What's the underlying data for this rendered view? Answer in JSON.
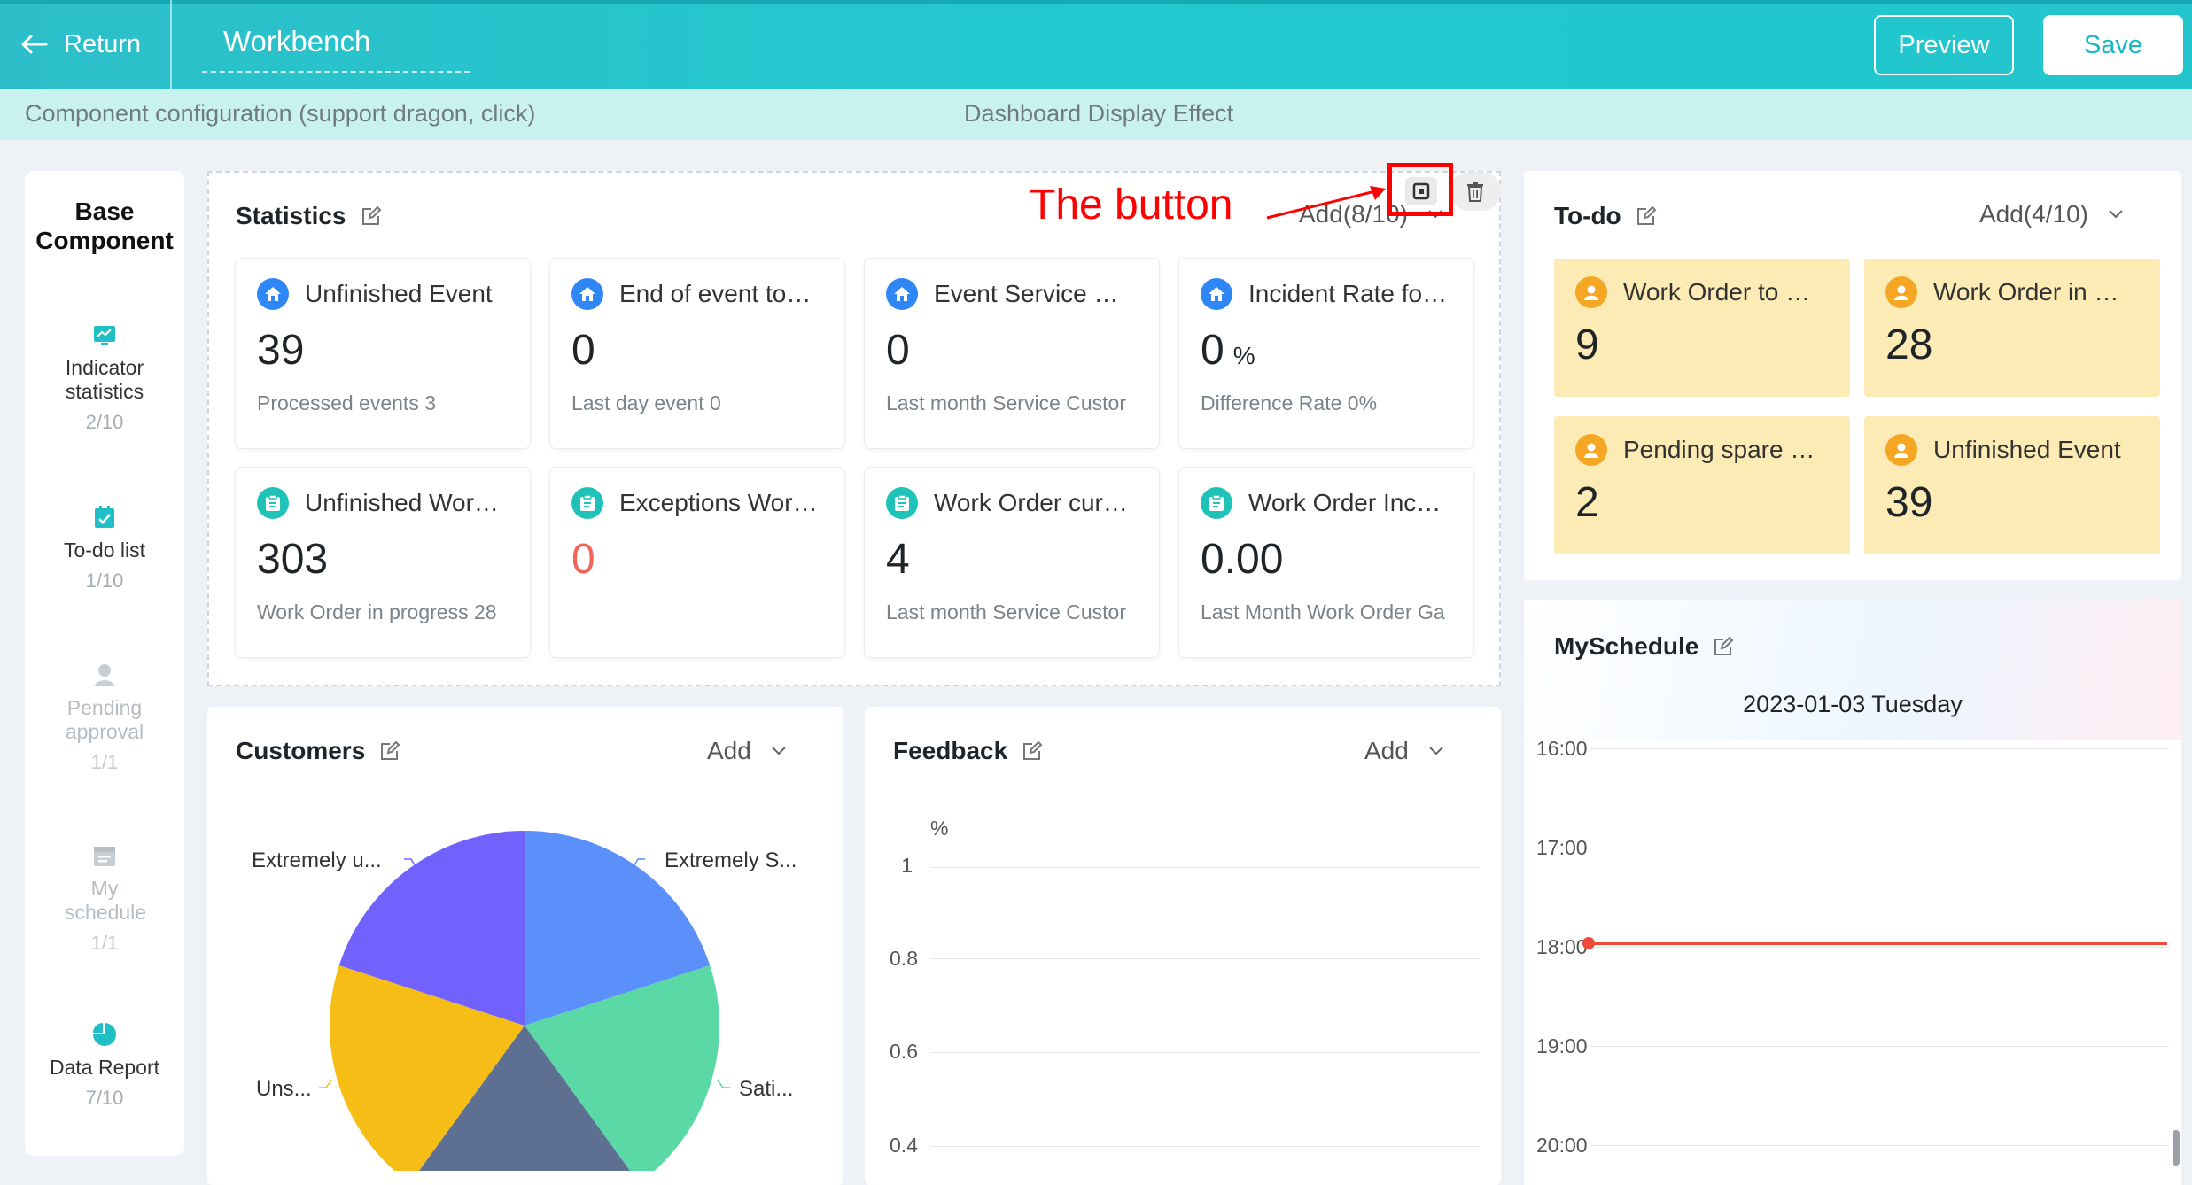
{
  "header": {
    "return_label": "Return",
    "title": "Workbench",
    "preview_label": "Preview",
    "save_label": "Save"
  },
  "subheader": {
    "left": "Component configuration (support dragon, click)",
    "center": "Dashboard Display Effect"
  },
  "palette": {
    "title": "Base Component",
    "items": [
      {
        "label": "Indicator statistics",
        "count": "2/10",
        "icon": "chart-icon",
        "enabled": true
      },
      {
        "label": "To-do list",
        "count": "1/10",
        "icon": "checklist-icon",
        "enabled": true
      },
      {
        "label": "Pending approval",
        "count": "1/1",
        "icon": "user-icon",
        "enabled": false
      },
      {
        "label": "My schedule",
        "count": "1/1",
        "icon": "calendar-icon",
        "enabled": false
      },
      {
        "label": "Data Report",
        "count": "7/10",
        "icon": "pie-chart-icon",
        "enabled": true
      }
    ]
  },
  "annotation": {
    "text": "The button"
  },
  "statistics": {
    "title": "Statistics",
    "add_label": "Add(8/10)",
    "tiles": [
      {
        "title": "Unfinished Event",
        "value": "39",
        "unit": "",
        "footer": "Processed events  3",
        "icon": "home-icon",
        "color": "#2f87f5"
      },
      {
        "title": "End of event to…",
        "value": "0",
        "unit": "",
        "footer": "Last day event  0",
        "icon": "home-icon",
        "color": "#2f87f5"
      },
      {
        "title": "Event Service …",
        "value": "0",
        "unit": "",
        "footer": "Last month Service Custor",
        "icon": "home-icon",
        "color": "#2f87f5"
      },
      {
        "title": "Incident Rate fo…",
        "value": "0",
        "unit": "%",
        "footer": "Difference Rate  0%",
        "icon": "home-icon",
        "color": "#2f87f5"
      },
      {
        "title": "Unfinished Wor…",
        "value": "303",
        "unit": "",
        "footer": "Work Order in progress  28",
        "icon": "clipboard-icon",
        "color": "#1fc2b6"
      },
      {
        "title": "Exceptions Wor…",
        "value": "0",
        "unit": "",
        "footer": "",
        "icon": "clipboard-icon",
        "color": "#1fc2b6",
        "value_color": "#f0655a"
      },
      {
        "title": "Work Order cur…",
        "value": "4",
        "unit": "",
        "footer": "Last month Service Custor",
        "icon": "clipboard-icon",
        "color": "#1fc2b6"
      },
      {
        "title": "Work Order Inc…",
        "value": "0.00",
        "unit": "",
        "footer": "Last Month Work Order Ga",
        "icon": "clipboard-icon",
        "color": "#1fc2b6"
      }
    ]
  },
  "customers": {
    "title": "Customers",
    "add_label": "Add",
    "labels": [
      "Extremely u...",
      "Extremely S...",
      "Uns...",
      "Sati..."
    ]
  },
  "chart_data": {
    "type": "pie",
    "slices": [
      {
        "name": "Extremely S...",
        "value": 20,
        "color": "#5b8ff9"
      },
      {
        "name": "Sati...",
        "value": 20,
        "color": "#5ad8a6"
      },
      {
        "name": "",
        "value": 20,
        "color": "#5d7092"
      },
      {
        "name": "Uns...",
        "value": 20,
        "color": "#f6bd16"
      },
      {
        "name": "Extremely u...",
        "value": 20,
        "color": "#7262fd"
      }
    ]
  },
  "feedback": {
    "title": "Feedback",
    "add_label": "Add",
    "unit_label": "%",
    "y_ticks": [
      "1",
      "0.8",
      "0.6",
      "0.4"
    ]
  },
  "todo": {
    "title": "To-do",
    "add_label": "Add(4/10)",
    "tiles": [
      {
        "title": "Work Order to …",
        "value": "9"
      },
      {
        "title": "Work Order in …",
        "value": "28"
      },
      {
        "title": "Pending spare …",
        "value": "2"
      },
      {
        "title": "Unfinished Event",
        "value": "39"
      }
    ]
  },
  "schedule": {
    "title": "MySchedule",
    "date": "2023-01-03 Tuesday",
    "times": [
      "16:00",
      "17:00",
      "18:00",
      "19:00",
      "20:00"
    ],
    "now_color": "#f04a3a"
  }
}
